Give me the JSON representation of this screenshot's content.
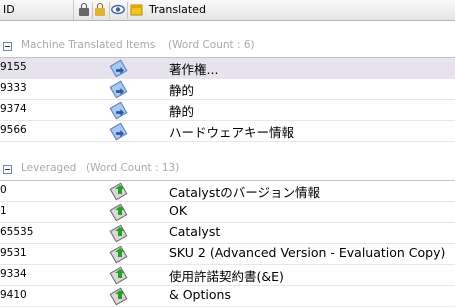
{
  "header": {
    "id_label": "ID",
    "translated_label": "Translated",
    "icons": [
      "lock-icon",
      "gold-lock-icon",
      "eye-icon",
      "note-icon"
    ]
  },
  "groups": [
    {
      "title": "Machine Translated Items",
      "count_label": "(Word Count : 6)",
      "icon": "machine-translation-icon",
      "rows": [
        {
          "id": "9155",
          "text": "著作権..."
        },
        {
          "id": "9333",
          "text": "静的"
        },
        {
          "id": "9374",
          "text": "静的"
        },
        {
          "id": "9566",
          "text": "ハードウェアキー情報"
        }
      ]
    },
    {
      "title": "Leveraged",
      "count_label": "(Word Count : 13)",
      "icon": "leveraged-icon",
      "rows": [
        {
          "id": "0",
          "text": "Catalystのバージョン情報"
        },
        {
          "id": "1",
          "text": "OK"
        },
        {
          "id": "65535",
          "text": "Catalyst"
        },
        {
          "id": "9531",
          "text": "SKU 2 (Advanced Version - Evaluation Copy)"
        },
        {
          "id": "9334",
          "text": "使用許諾契約書(&E)"
        },
        {
          "id": "9410",
          "text": "& Options"
        }
      ]
    }
  ],
  "colors": {
    "selected_row": "#e7e3ee",
    "group_text": "#aaaaaa",
    "header_bg": "#eeeeee"
  }
}
